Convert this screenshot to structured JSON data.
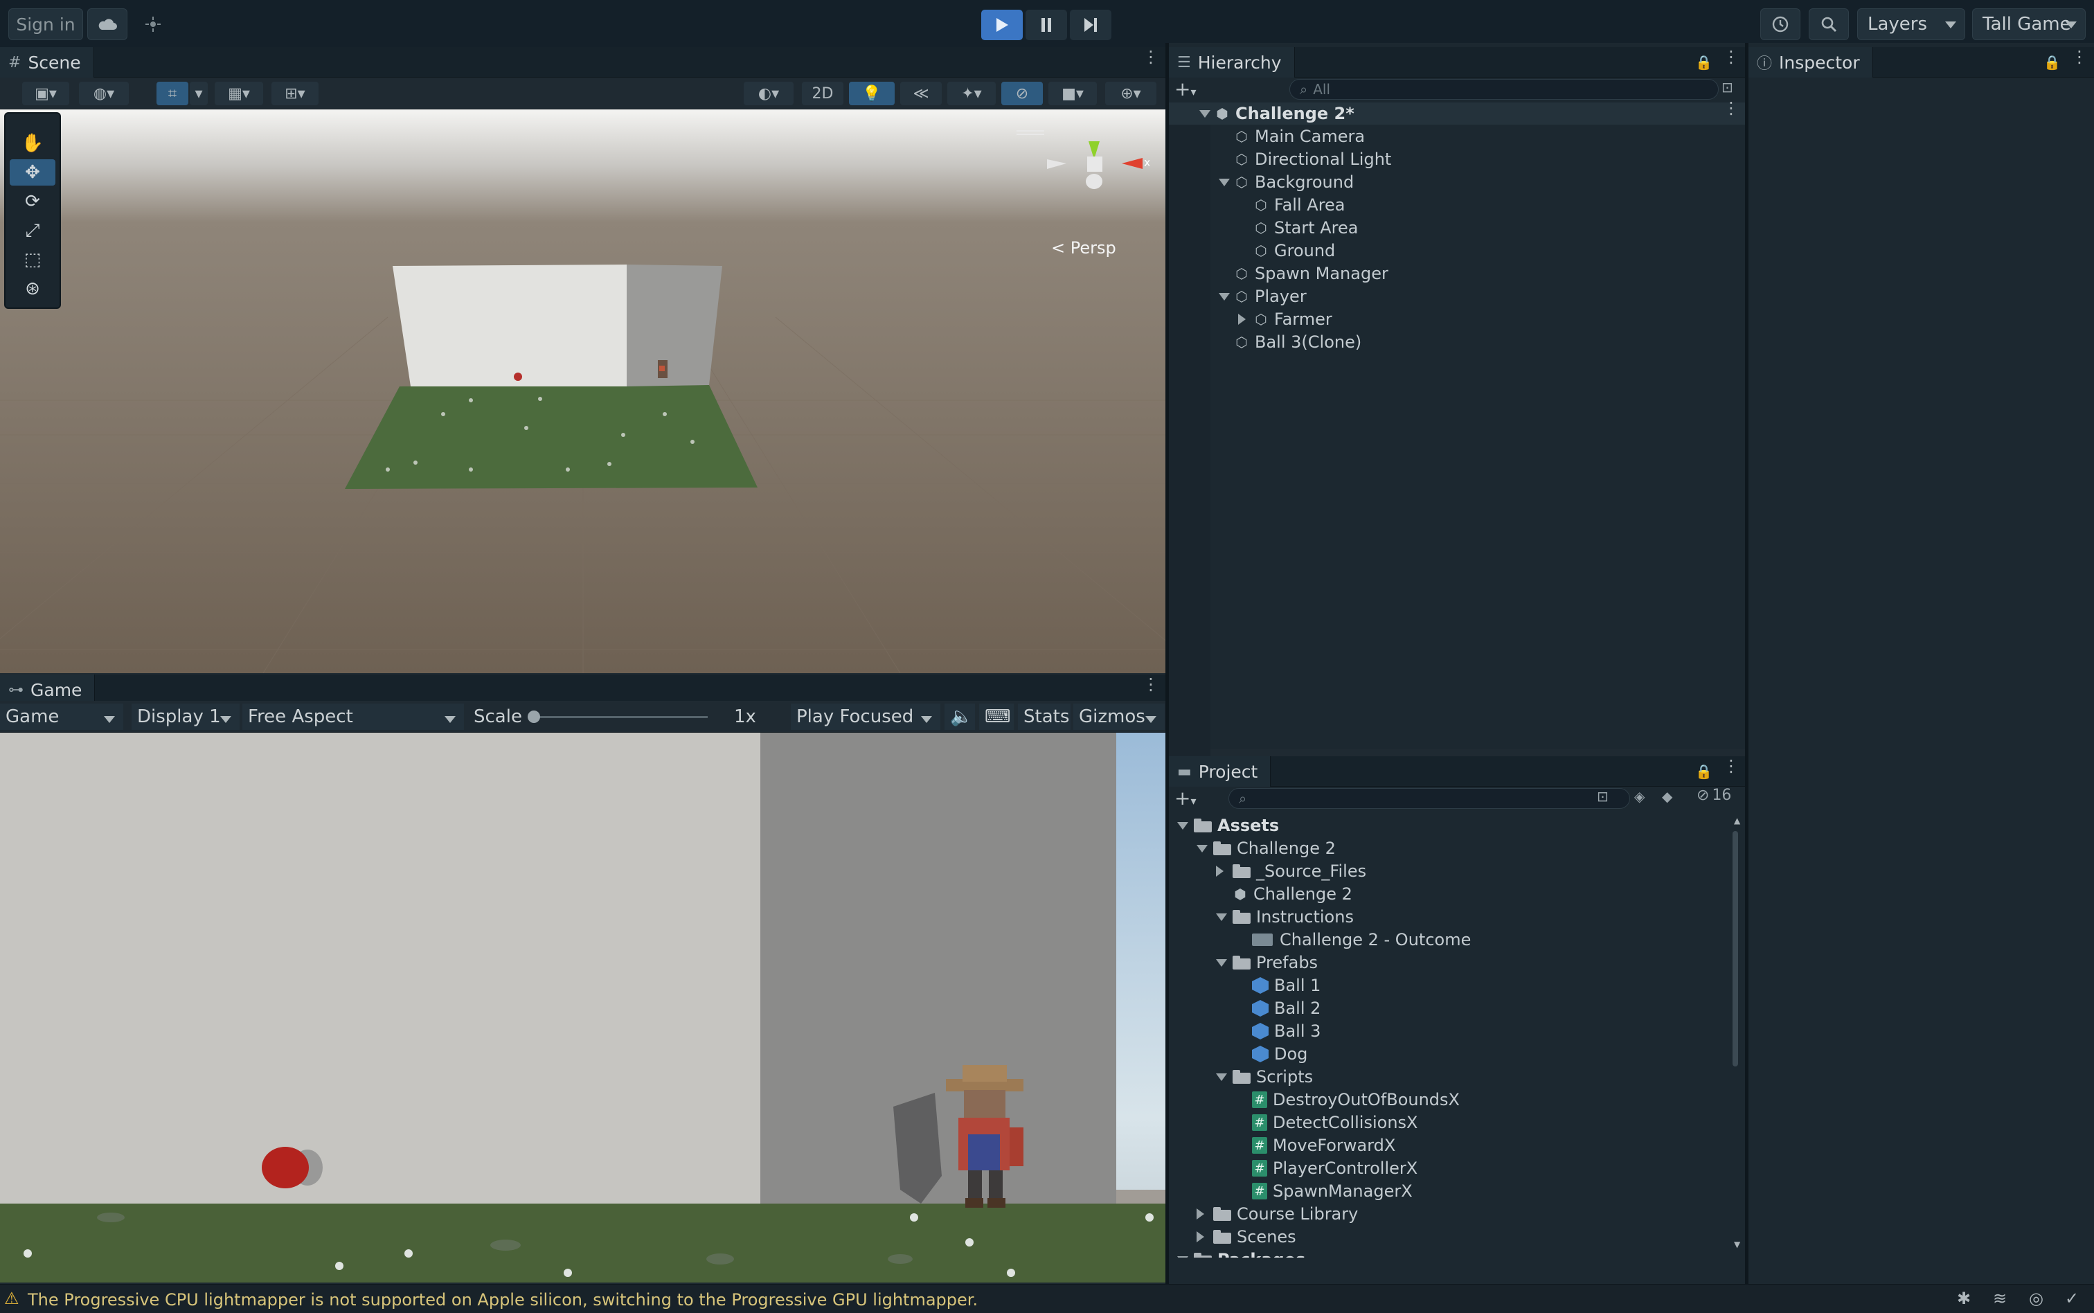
{
  "topbar": {
    "sign_in": "Sign in",
    "layers": "Layers",
    "layout": "Tall Game"
  },
  "scene": {
    "tab": "Scene",
    "toggle_2d": "2D",
    "persp": "Persp",
    "axis_x": "x"
  },
  "game": {
    "tab": "Game",
    "mode": "Game",
    "display": "Display 1",
    "aspect": "Free Aspect",
    "scale_label": "Scale",
    "scale_value": "1x",
    "scale_fraction": 0.0,
    "play_focused": "Play Focused",
    "stats": "Stats",
    "gizmos": "Gizmos"
  },
  "hierarchy": {
    "tab": "Hierarchy",
    "search_placeholder": "All",
    "items": [
      {
        "label": "Challenge 2*",
        "depth": 0,
        "type": "scene",
        "expanded": true
      },
      {
        "label": "Main Camera",
        "depth": 1,
        "type": "object"
      },
      {
        "label": "Directional Light",
        "depth": 1,
        "type": "object"
      },
      {
        "label": "Background",
        "depth": 1,
        "type": "object",
        "expanded": true
      },
      {
        "label": "Fall Area",
        "depth": 2,
        "type": "object"
      },
      {
        "label": "Start Area",
        "depth": 2,
        "type": "object"
      },
      {
        "label": "Ground",
        "depth": 2,
        "type": "object"
      },
      {
        "label": "Spawn Manager",
        "depth": 1,
        "type": "object"
      },
      {
        "label": "Player",
        "depth": 1,
        "type": "object",
        "expanded": true
      },
      {
        "label": "Farmer",
        "depth": 2,
        "type": "object",
        "collapsed": true
      },
      {
        "label": "Ball 3(Clone)",
        "depth": 1,
        "type": "object"
      }
    ]
  },
  "inspector": {
    "tab": "Inspector"
  },
  "project": {
    "tab": "Project",
    "hidden_count": "16",
    "items": [
      {
        "label": "Assets",
        "depth": 0,
        "type": "folder",
        "expanded": true,
        "bold": true
      },
      {
        "label": "Challenge 2",
        "depth": 1,
        "type": "folder",
        "expanded": true
      },
      {
        "label": "_Source_Files",
        "depth": 2,
        "type": "folder",
        "collapsed": true
      },
      {
        "label": "Challenge 2",
        "depth": 2,
        "type": "scene"
      },
      {
        "label": "Instructions",
        "depth": 2,
        "type": "folder",
        "expanded": true
      },
      {
        "label": "Challenge 2 - Outcome",
        "depth": 3,
        "type": "video"
      },
      {
        "label": "Prefabs",
        "depth": 2,
        "type": "folder",
        "expanded": true
      },
      {
        "label": "Ball 1",
        "depth": 3,
        "type": "prefab"
      },
      {
        "label": "Ball 2",
        "depth": 3,
        "type": "prefab"
      },
      {
        "label": "Ball 3",
        "depth": 3,
        "type": "prefab"
      },
      {
        "label": "Dog",
        "depth": 3,
        "type": "prefab"
      },
      {
        "label": "Scripts",
        "depth": 2,
        "type": "folder",
        "expanded": true
      },
      {
        "label": "DestroyOutOfBoundsX",
        "depth": 3,
        "type": "script"
      },
      {
        "label": "DetectCollisionsX",
        "depth": 3,
        "type": "script"
      },
      {
        "label": "MoveForwardX",
        "depth": 3,
        "type": "script"
      },
      {
        "label": "PlayerControllerX",
        "depth": 3,
        "type": "script"
      },
      {
        "label": "SpawnManagerX",
        "depth": 3,
        "type": "script"
      },
      {
        "label": "Course Library",
        "depth": 1,
        "type": "folder",
        "collapsed": true
      },
      {
        "label": "Scenes",
        "depth": 1,
        "type": "folder",
        "collapsed": true
      },
      {
        "label": "Packages",
        "depth": 0,
        "type": "folder",
        "expanded": true,
        "bold": true
      }
    ]
  },
  "status": {
    "message": "The Progressive CPU lightmapper is not supported on Apple silicon, switching to the Progressive GPU lightmapper."
  },
  "colors": {
    "accent_play": "#3b76c4",
    "warning": "#e0b23a",
    "status_text": "#d7c47a"
  }
}
